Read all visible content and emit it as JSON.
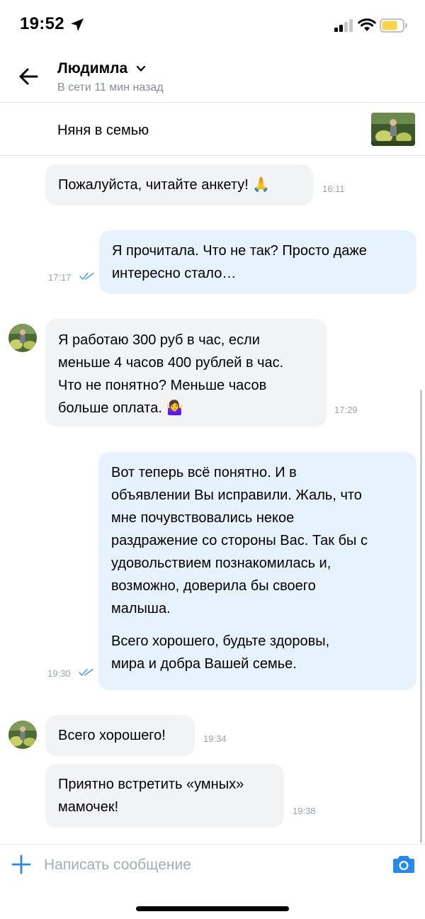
{
  "status_bar": {
    "time": "19:52"
  },
  "header": {
    "contact_name": "Людимла",
    "online_status": "В сети 11 мин назад"
  },
  "listing": {
    "title": "Няня в семью"
  },
  "messages": [
    {
      "direction": "in",
      "text": "Пожалуйста, читайте анкету! 🙏",
      "time": "16:11"
    },
    {
      "direction": "out",
      "lines": [
        "Я прочитала. Что не так? Просто даже",
        "интересно стало…"
      ],
      "time": "17:17",
      "read": true
    },
    {
      "direction": "in",
      "lines": [
        "Я работаю 300 руб в час, если",
        "меньше 4 часов 400 рублей в час.",
        "Что не понятно? Меньше часов",
        "больше оплата. 🤷‍♀️"
      ],
      "time": "17:29"
    },
    {
      "direction": "out",
      "lines": [
        "Вот теперь всё понятно. И в",
        "объявлении Вы исправили. Жаль, что",
        "мне почувствовались некое",
        "раздражение со стороны Вас. Так бы с",
        "удовольствием познакомилась и,",
        "возможно, доверила бы своего",
        "малыша.",
        "",
        "Всего хорошего, будьте здоровы,",
        "мира и добра Вашей семье."
      ],
      "time": "19:30",
      "read": true
    },
    {
      "direction": "in",
      "text": "Всего хорошего!",
      "time": "19:34"
    },
    {
      "direction": "in",
      "lines": [
        "Приятно встретить «умных»",
        "мамочек!"
      ],
      "time": "19:38"
    }
  ],
  "composer": {
    "placeholder": "Написать сообщение"
  },
  "icons": {
    "back": "arrow-left-icon",
    "chevron": "chevron-down-icon",
    "read_receipt": "double-check-icon",
    "attach": "plus-icon",
    "camera": "camera-icon"
  },
  "colors": {
    "accent": "#2688eb",
    "incoming_bubble": "#f2f3f5",
    "outgoing_bubble": "#e6f2fd",
    "secondary_text": "#818c99",
    "battery": "#f6d44c"
  }
}
